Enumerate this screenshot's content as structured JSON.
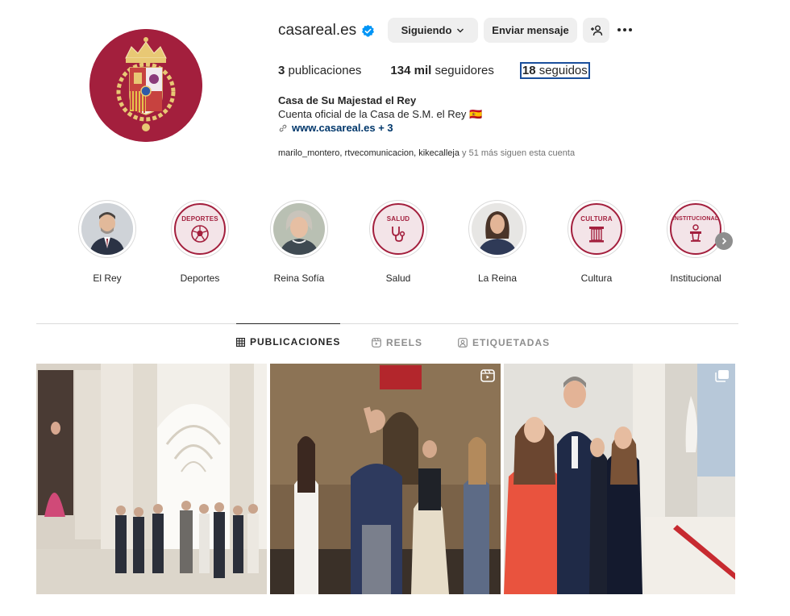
{
  "profile": {
    "username": "casareal.es",
    "verified": true,
    "buttons": {
      "following": "Siguiendo",
      "message": "Enviar mensaje"
    },
    "stats": {
      "posts_count": "3",
      "posts_label": "publicaciones",
      "followers_count": "134 mil",
      "followers_label": "seguidores",
      "following_count": "18",
      "following_label": "seguidos"
    },
    "bio": {
      "name": "Casa de Su Majestad el Rey",
      "description": "Cuenta oficial de la Casa de S.M. el Rey 🇪🇸",
      "link": "www.casareal.es + 3"
    },
    "followed_by": {
      "names": "marilo_montero, rtvecomunicacion, kikecalleja",
      "rest": "y 51 más siguen esta cuenta"
    }
  },
  "highlights": [
    {
      "label": "El Rey",
      "type": "photo"
    },
    {
      "label": "Deportes",
      "type": "icon",
      "tag": "DEPORTES",
      "icon": "soccer-ball-icon"
    },
    {
      "label": "Reina Sofía",
      "type": "photo"
    },
    {
      "label": "Salud",
      "type": "icon",
      "tag": "SALUD",
      "icon": "stethoscope-icon"
    },
    {
      "label": "La Reina",
      "type": "photo"
    },
    {
      "label": "Cultura",
      "type": "icon",
      "tag": "CULTURA",
      "icon": "column-icon"
    },
    {
      "label": "Institucional",
      "type": "icon",
      "tag": "INSTITUCIONAL",
      "icon": "podium-icon"
    }
  ],
  "tabs": [
    {
      "label": "PUBLICACIONES",
      "icon": "grid-icon",
      "active": true
    },
    {
      "label": "REELS",
      "icon": "reels-icon",
      "active": false
    },
    {
      "label": "ETIQUETADAS",
      "icon": "tagged-icon",
      "active": false
    }
  ],
  "colors": {
    "brand_red": "#a31f3d",
    "verified_blue": "#0095f6",
    "link_blue": "#00376b",
    "focus_outline": "#1b4f9c"
  }
}
